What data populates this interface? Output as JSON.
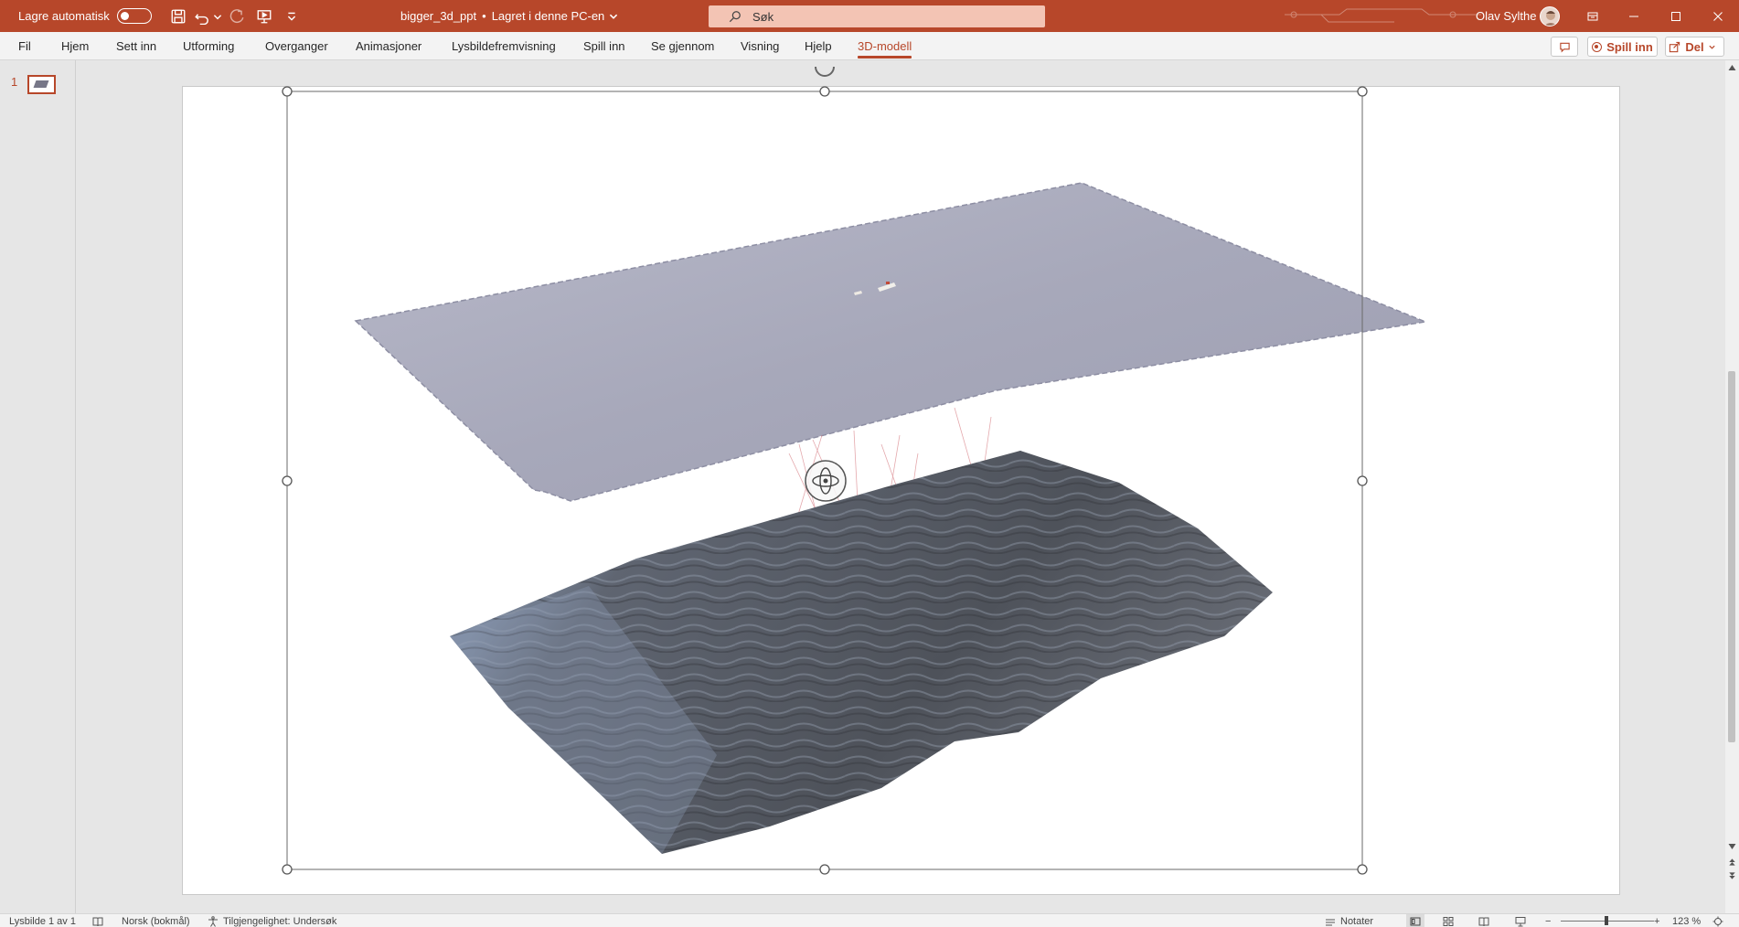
{
  "titlebar": {
    "autosave_label": "Lagre automatisk",
    "doc_name": "bigger_3d_ppt",
    "separator": "•",
    "save_status": "Lagret i denne PC-en",
    "search_placeholder": "Søk",
    "user_name": "Olav Sylthe"
  },
  "ribbon": {
    "tabs": [
      {
        "label": "Fil"
      },
      {
        "label": "Hjem"
      },
      {
        "label": "Sett inn"
      },
      {
        "label": "Utforming"
      },
      {
        "label": "Overganger"
      },
      {
        "label": "Animasjoner"
      },
      {
        "label": "Lysbildefremvisning"
      },
      {
        "label": "Spill inn"
      },
      {
        "label": "Se gjennom"
      },
      {
        "label": "Visning"
      },
      {
        "label": "Hjelp"
      },
      {
        "label": "3D-modell"
      }
    ],
    "active_tab": "3D-modell",
    "record_label": "Spill inn",
    "share_label": "Del"
  },
  "thumbnails": {
    "items": [
      {
        "number": "1"
      }
    ]
  },
  "statusbar": {
    "slide_info": "Lysbilde 1 av 1",
    "language": "Norsk (bokmål)",
    "accessibility": "Tilgjengelighet: Undersøk",
    "notes_label": "Notater",
    "zoom_minus": "−",
    "zoom_plus": "+",
    "zoom_level": "123 %"
  },
  "colors": {
    "accent": "#b7472a",
    "titlebar_bg": "#b7472a",
    "ribbon_bg": "#f3f3f3",
    "workspace_bg": "#e6e6e6"
  }
}
